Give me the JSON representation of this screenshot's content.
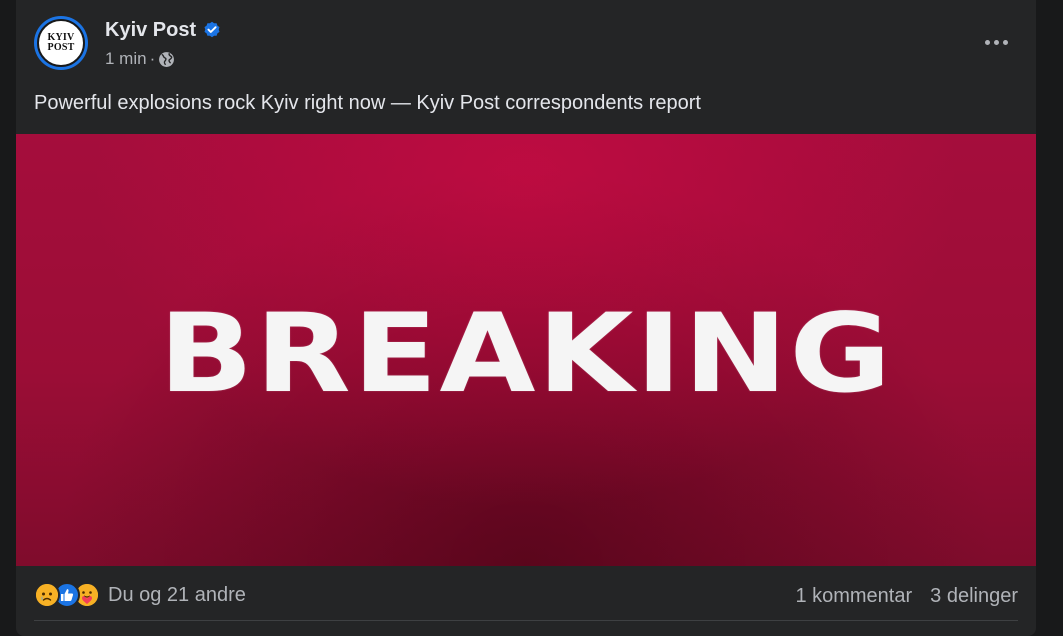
{
  "post": {
    "page_name": "Kyiv Post",
    "avatar_lines": [
      "KYIV",
      "POST"
    ],
    "timestamp": "1 min",
    "separator": "·",
    "audience_icon": "globe-icon",
    "verified_icon": "verified-badge-icon",
    "more_icon": "more-options-icon",
    "text": "Powerful explosions rock Kyiv right now — Kyiv Post correspondents report",
    "image": {
      "headline": "BREAKING"
    }
  },
  "footer": {
    "reactions": [
      "sad-reaction-icon",
      "like-reaction-icon",
      "care-reaction-icon"
    ],
    "reaction_summary": "Du og 21 andre",
    "comments": "1 kommentar",
    "shares": "3 delinger"
  },
  "colors": {
    "background": "#18191a",
    "card": "#242526",
    "primary_text": "#e4e6eb",
    "secondary_text": "#b0b3b8",
    "verified_blue": "#1b74e4",
    "banner_red": "#9b0d36"
  }
}
